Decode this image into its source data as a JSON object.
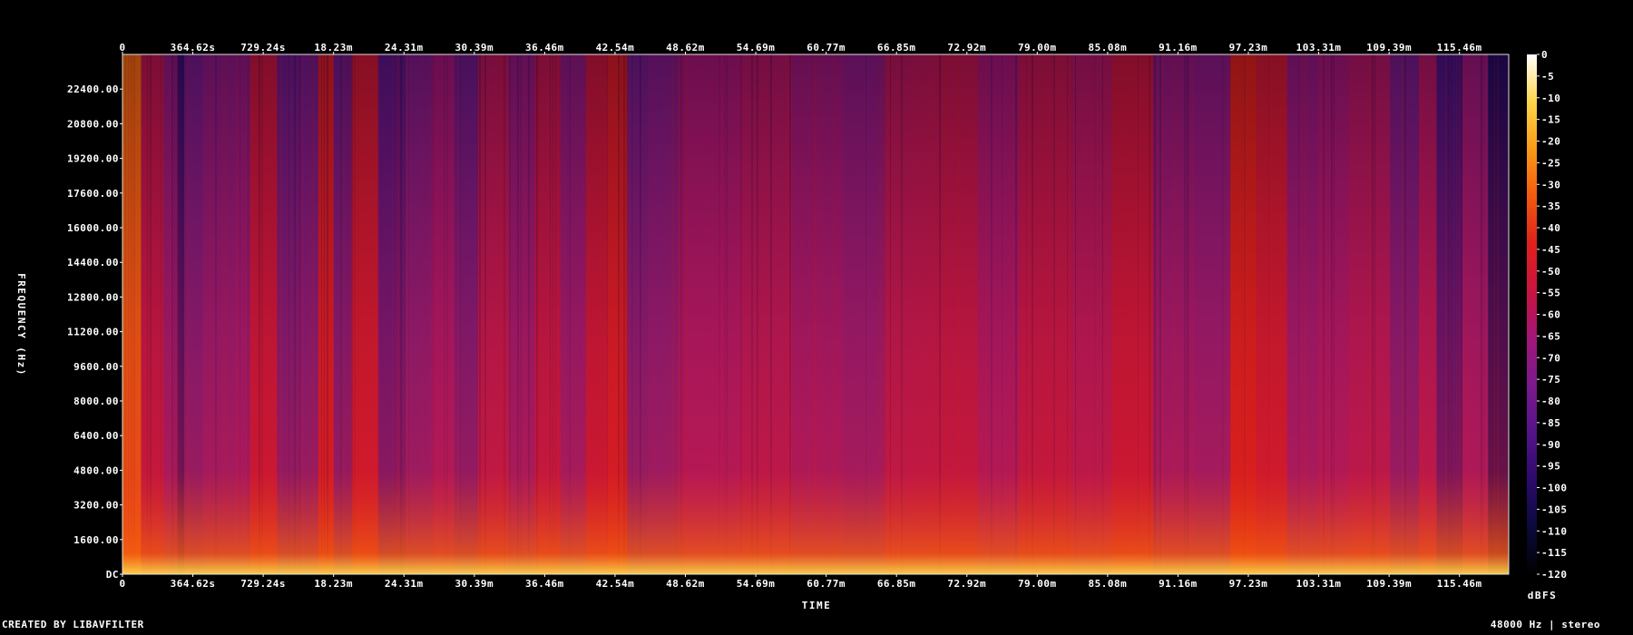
{
  "chart_data": {
    "type": "heatmap",
    "title": "",
    "xlabel": "TIME",
    "ylabel": "FREQUENCY (Hz)",
    "x_ticks": [
      "0",
      "364.62s",
      "729.24s",
      "18.23m",
      "24.31m",
      "30.39m",
      "36.46m",
      "42.54m",
      "48.62m",
      "54.69m",
      "60.77m",
      "66.85m",
      "72.92m",
      "79.00m",
      "85.08m",
      "91.16m",
      "97.23m",
      "103.31m",
      "109.39m",
      "115.46m"
    ],
    "y_ticks": [
      "DC",
      "1600.00",
      "3200.00",
      "4800.00",
      "6400.00",
      "8000.00",
      "9600.00",
      "11200.00",
      "12800.00",
      "14400.00",
      "16000.00",
      "17600.00",
      "19200.00",
      "20800.00",
      "22400.00"
    ],
    "ylim": [
      0,
      24000
    ],
    "colorbar": {
      "label": "dBFS",
      "ticks": [
        "0",
        "-5",
        "-10",
        "-15",
        "-20",
        "-25",
        "-30",
        "-35",
        "-40",
        "-45",
        "-50",
        "-55",
        "-60",
        "-65",
        "-70",
        "-75",
        "-80",
        "-85",
        "-90",
        "-95",
        "-100",
        "-105",
        "-110",
        "-115",
        "-120"
      ],
      "range": [
        -120,
        0
      ],
      "stops": [
        "#000000",
        "#0a0a3c",
        "#2c0a6b",
        "#55138a",
        "#7a1a8c",
        "#a3157a",
        "#c8143f",
        "#e0201c",
        "#f25a0e",
        "#fa9a18",
        "#fdd54a",
        "#ffffff"
      ]
    },
    "segments": [
      {
        "start": 0,
        "end": 18,
        "level": -30
      },
      {
        "start": 18,
        "end": 40,
        "level": -58
      },
      {
        "start": 40,
        "end": 53,
        "level": -70
      },
      {
        "start": 53,
        "end": 60,
        "level": -95
      },
      {
        "start": 60,
        "end": 78,
        "level": -78
      },
      {
        "start": 78,
        "end": 108,
        "level": -72
      },
      {
        "start": 108,
        "end": 124,
        "level": -70
      },
      {
        "start": 124,
        "end": 150,
        "level": -55
      },
      {
        "start": 150,
        "end": 172,
        "level": -80
      },
      {
        "start": 172,
        "end": 190,
        "level": -78
      },
      {
        "start": 190,
        "end": 205,
        "level": -48
      },
      {
        "start": 205,
        "end": 222,
        "level": -80
      },
      {
        "start": 222,
        "end": 248,
        "level": -52
      },
      {
        "start": 248,
        "end": 275,
        "level": -85
      },
      {
        "start": 275,
        "end": 300,
        "level": -75
      },
      {
        "start": 300,
        "end": 322,
        "level": -66
      },
      {
        "start": 322,
        "end": 345,
        "level": -80
      },
      {
        "start": 345,
        "end": 375,
        "level": -60
      },
      {
        "start": 375,
        "end": 400,
        "level": -70
      },
      {
        "start": 400,
        "end": 425,
        "level": -58
      },
      {
        "start": 425,
        "end": 450,
        "level": -72
      },
      {
        "start": 450,
        "end": 470,
        "level": -55
      },
      {
        "start": 470,
        "end": 490,
        "level": -48
      },
      {
        "start": 490,
        "end": 510,
        "level": -78
      },
      {
        "start": 510,
        "end": 540,
        "level": -75
      },
      {
        "start": 540,
        "end": 600,
        "level": -65
      },
      {
        "start": 600,
        "end": 650,
        "level": -62
      },
      {
        "start": 650,
        "end": 700,
        "level": -68
      },
      {
        "start": 700,
        "end": 740,
        "level": -72
      },
      {
        "start": 740,
        "end": 790,
        "level": -60
      },
      {
        "start": 790,
        "end": 830,
        "level": -58
      },
      {
        "start": 830,
        "end": 870,
        "level": -66
      },
      {
        "start": 870,
        "end": 920,
        "level": -58
      },
      {
        "start": 920,
        "end": 960,
        "level": -62
      },
      {
        "start": 960,
        "end": 1000,
        "level": -55
      },
      {
        "start": 1000,
        "end": 1040,
        "level": -70
      },
      {
        "start": 1040,
        "end": 1075,
        "level": -72
      },
      {
        "start": 1075,
        "end": 1100,
        "level": -45
      },
      {
        "start": 1100,
        "end": 1130,
        "level": -52
      },
      {
        "start": 1130,
        "end": 1160,
        "level": -70
      },
      {
        "start": 1160,
        "end": 1190,
        "level": -66
      },
      {
        "start": 1190,
        "end": 1230,
        "level": -62
      },
      {
        "start": 1230,
        "end": 1258,
        "level": -78
      },
      {
        "start": 1258,
        "end": 1275,
        "level": -62
      },
      {
        "start": 1275,
        "end": 1300,
        "level": -90
      },
      {
        "start": 1300,
        "end": 1325,
        "level": -68
      },
      {
        "start": 1325,
        "end": 1345,
        "level": -100
      }
    ]
  },
  "footer": {
    "left": "CREATED BY LIBAVFILTER",
    "right": "48000 Hz | stereo"
  }
}
